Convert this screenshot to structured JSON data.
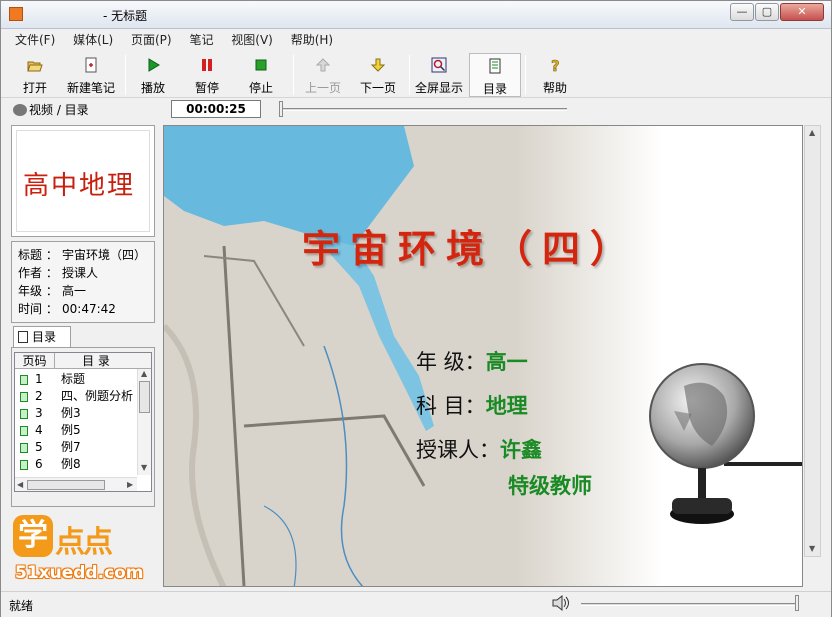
{
  "window": {
    "title": "- 无标题",
    "controls": {
      "minimize": "—",
      "maximize": "▢",
      "close": "✕"
    }
  },
  "menu": [
    {
      "label": "文件(F)"
    },
    {
      "label": "媒体(L)"
    },
    {
      "label": "页面(P)"
    },
    {
      "label": "笔记"
    },
    {
      "label": "视图(V)"
    },
    {
      "label": "帮助(H)"
    }
  ],
  "toolbar": {
    "open": {
      "label": "打开",
      "icon": "open-folder-icon"
    },
    "new_note": {
      "label": "新建笔记",
      "icon": "new-note-icon"
    },
    "play": {
      "label": "播放",
      "icon": "play-icon"
    },
    "pause": {
      "label": "暂停",
      "icon": "pause-icon"
    },
    "stop": {
      "label": "停止",
      "icon": "stop-icon"
    },
    "prev": {
      "label": "上一页",
      "icon": "arrow-up-icon",
      "disabled": true
    },
    "next": {
      "label": "下一页",
      "icon": "arrow-down-icon"
    },
    "fullscreen": {
      "label": "全屏显示",
      "icon": "fullscreen-icon"
    },
    "toc": {
      "label": "目录",
      "icon": "toc-book-icon",
      "pressed": true
    },
    "help": {
      "label": "帮助",
      "icon": "help-icon"
    }
  },
  "strip": {
    "video_tab": "视频 / 目录",
    "time": "00:00:25"
  },
  "cover": {
    "title": "高中地理"
  },
  "meta": [
    {
      "key": "标题 ：",
      "value": "宇宙环境（四）"
    },
    {
      "key": "作者 ：",
      "value": "授课人"
    },
    {
      "key": "年级 ：",
      "value": "高一"
    },
    {
      "key": "时间 ：",
      "value": "00:47:42"
    }
  ],
  "toc": {
    "tab_label": "目录",
    "col_page": "页码",
    "col_title": "目  录",
    "rows": [
      {
        "page": "1",
        "title": "标题"
      },
      {
        "page": "2",
        "title": "四、例题分析"
      },
      {
        "page": "3",
        "title": "例3"
      },
      {
        "page": "4",
        "title": "例5"
      },
      {
        "page": "5",
        "title": "例7"
      },
      {
        "page": "6",
        "title": "例8"
      }
    ]
  },
  "logo": {
    "mark": "学",
    "word": "点点",
    "url": "51xuedd.com"
  },
  "slide": {
    "title": "宇宙环境（四）",
    "grade_key": "年  级：",
    "grade_value": "高一",
    "subject_key": "科  目：",
    "subject_value": "地理",
    "teacher_key": "授课人：",
    "teacher_value": "许鑫",
    "teacher_title": "特级教师"
  },
  "status": {
    "text": "就绪"
  },
  "colors": {
    "title_red": "#d4260e",
    "value_green": "#1a8a24",
    "logo_orange": "#f49a1a",
    "sea_blue": "#5bb6e0"
  }
}
